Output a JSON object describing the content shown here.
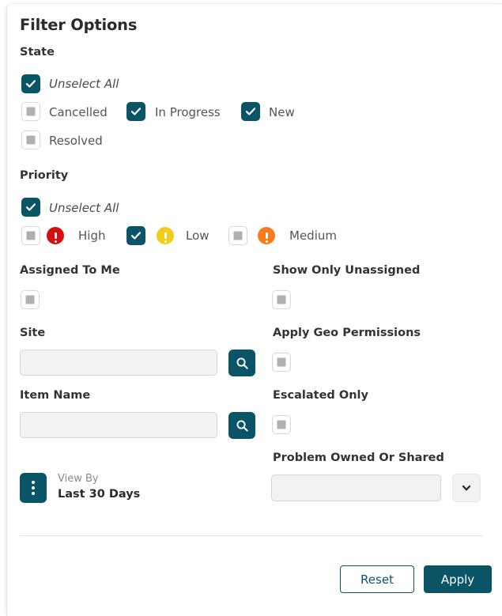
{
  "panel": {
    "title": "Filter Options"
  },
  "colors": {
    "accent_teal": "#0a5468",
    "priority_high": "#d50f0f",
    "priority_low": "#f2cb1d",
    "priority_medium": "#f97b1e",
    "input_bg": "#f2f2f2",
    "checkbox_inner": "#b0b0b0"
  },
  "state_section": {
    "label": "State",
    "unselect_all": {
      "label": "Unselect All",
      "checked": true
    },
    "options": [
      {
        "label": "Cancelled",
        "checked": false
      },
      {
        "label": "In Progress",
        "checked": true
      },
      {
        "label": "New",
        "checked": true
      },
      {
        "label": "Resolved",
        "checked": false
      }
    ]
  },
  "priority_section": {
    "label": "Priority",
    "unselect_all": {
      "label": "Unselect All",
      "checked": true
    },
    "options": [
      {
        "label": "High",
        "checked": false,
        "icon": "priority-high-icon",
        "color": "#d50f0f"
      },
      {
        "label": "Low",
        "checked": true,
        "icon": "priority-low-icon",
        "color": "#f2cb1d"
      },
      {
        "label": "Medium",
        "checked": false,
        "icon": "priority-medium-icon",
        "color": "#f97b1e"
      }
    ]
  },
  "toggles": {
    "assigned_to_me": {
      "label": "Assigned To Me",
      "checked": false
    },
    "show_only_unassigned": {
      "label": "Show Only Unassigned",
      "checked": false
    },
    "apply_geo_permissions": {
      "label": "Apply Geo Permissions",
      "checked": false
    },
    "escalated_only": {
      "label": "Escalated Only",
      "checked": false
    }
  },
  "fields": {
    "site": {
      "label": "Site",
      "value": "",
      "placeholder": "",
      "search_icon": "search-icon"
    },
    "item_name": {
      "label": "Item Name",
      "value": "",
      "placeholder": "",
      "search_icon": "search-icon"
    },
    "problem_owned_or_shared": {
      "label": "Problem Owned Or Shared",
      "value": "",
      "placeholder": "",
      "dropdown_icon": "chevron-down-icon"
    }
  },
  "view_by": {
    "icon": "more-vertical-icon",
    "caption": "View By",
    "value": "Last 30 Days"
  },
  "footer": {
    "reset_label": "Reset",
    "apply_label": "Apply"
  }
}
